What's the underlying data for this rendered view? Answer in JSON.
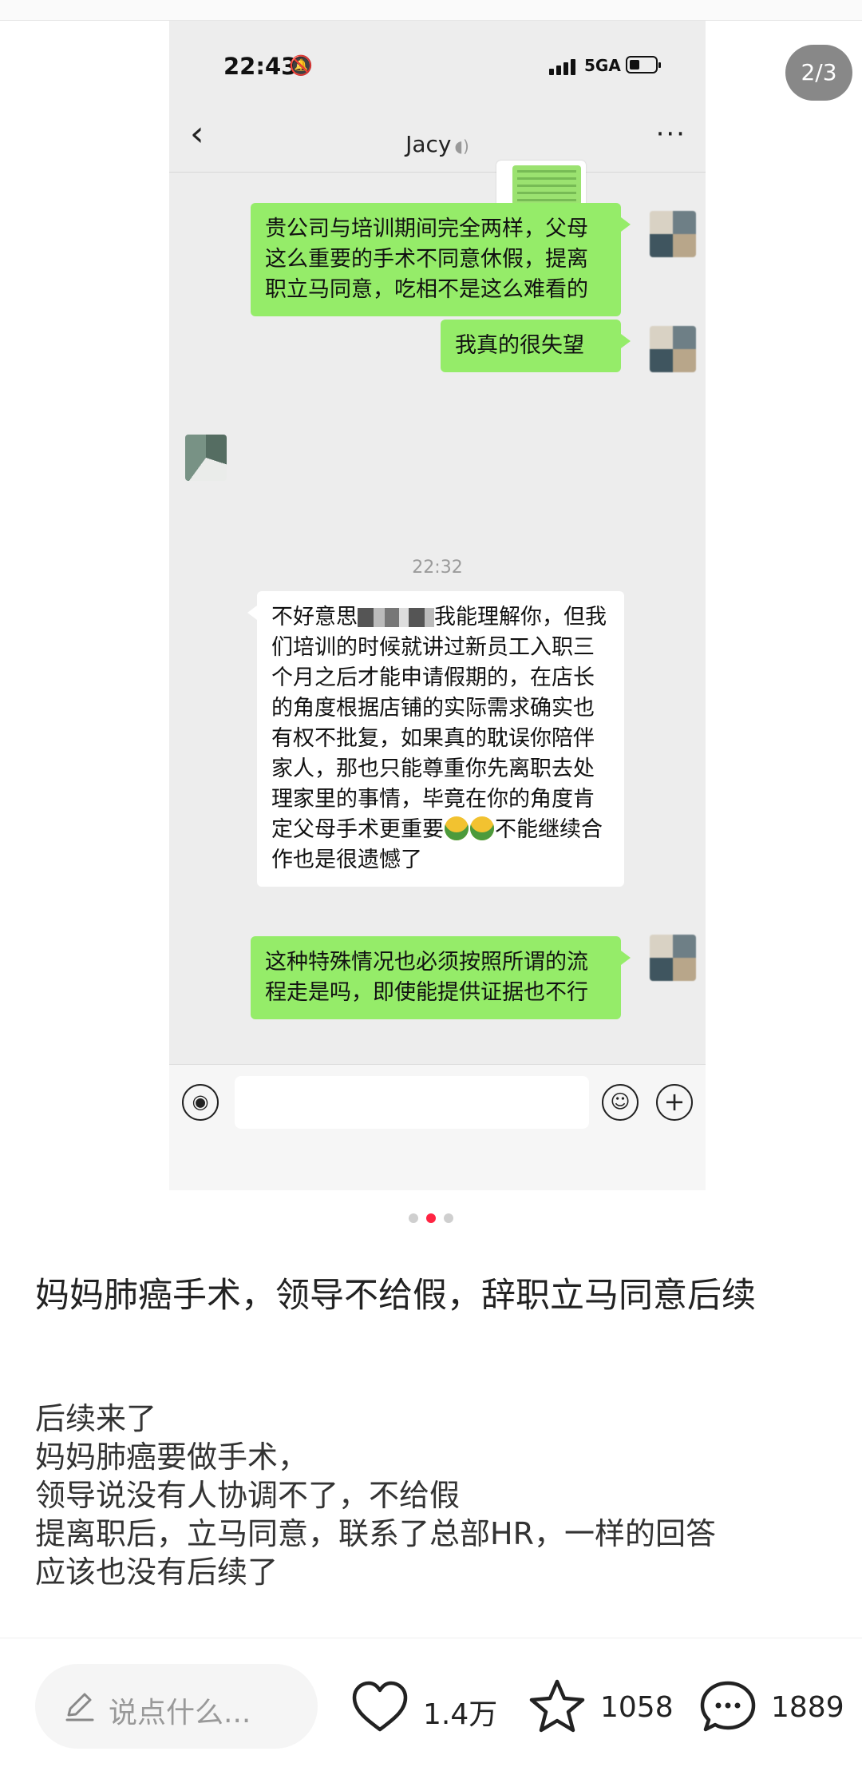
{
  "image_counter": "2/3",
  "screenshot": {
    "status_bar": {
      "time": "22:43",
      "network": "5GA"
    },
    "chat_title": "Jacy",
    "messages": {
      "me_1": "贵公司与培训期间完全两样，父母这么重要的手术不同意休假，提离职立马同意，吃相不是这么难看的",
      "me_2": "我真的很失望",
      "time_divider": "22:32",
      "other_1a": "不好意思",
      "other_1b": "我能理解你，但我们培训的时候就讲过新员工入职三个月之后才能申请假期的，在店长的角度根据店铺的实际需求确实也有权不批复，如果真的耽误你陪伴家人，那也只能尊重你先离职去处理家里的事情，毕竟在你的角度肯定父母手术更重要",
      "other_1c": "不能继续合作也是很遗憾了",
      "me_3": "这种特殊情况也必须按照所谓的流程走是吗，即使能提供证据也不行"
    }
  },
  "carousel": {
    "count": 3,
    "active_index": 1
  },
  "post": {
    "title": "妈妈肺癌手术，领导不给假，辞职立马同意后续",
    "body_lines": [
      "后续来了",
      "妈妈肺癌要做手术，",
      "领导说没有人协调不了，不给假",
      "提离职后，立马同意，联系了总部HR，一样的回答",
      "应该也没有后续了"
    ]
  },
  "bottom_bar": {
    "comment_placeholder": "说点什么...",
    "likes": "1.4万",
    "favorites": "1058",
    "comments": "1889"
  },
  "colors": {
    "accent": "#ff2442",
    "wechat_green": "#95ec69"
  }
}
